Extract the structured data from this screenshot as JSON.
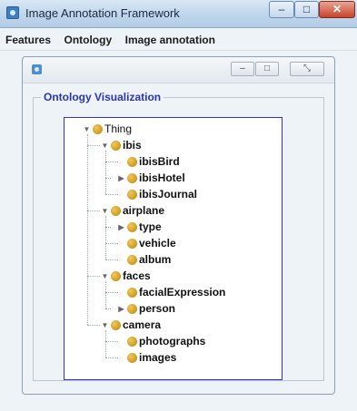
{
  "window": {
    "title": "Image Annotation Framework",
    "controls": {
      "minimize": "–",
      "maximize": "□",
      "close": "✕"
    }
  },
  "menu": [
    "Features",
    "Ontology",
    "Image annotation"
  ],
  "inner_window": {
    "controls": {
      "minimize": "–",
      "maximize": "□",
      "close": "⤡"
    }
  },
  "panel": {
    "title": "Ontology Visualization"
  },
  "tree": {
    "root": "Thing",
    "groups": [
      {
        "label": "ibis",
        "expanded": true,
        "children": [
          {
            "label": "ibisBird",
            "expandable": false
          },
          {
            "label": "ibisHotel",
            "expandable": true
          },
          {
            "label": "ibisJournal",
            "expandable": false
          }
        ]
      },
      {
        "label": "airplane",
        "expanded": true,
        "children": [
          {
            "label": "type",
            "expandable": true
          },
          {
            "label": "vehicle",
            "expandable": false
          },
          {
            "label": "album",
            "expandable": false
          }
        ]
      },
      {
        "label": "faces",
        "expanded": true,
        "children": [
          {
            "label": "facialExpression",
            "expandable": false
          },
          {
            "label": "person",
            "expandable": true
          }
        ]
      },
      {
        "label": "camera",
        "expanded": true,
        "children": [
          {
            "label": "photographs",
            "expandable": false
          },
          {
            "label": "images",
            "expandable": false
          }
        ]
      }
    ]
  }
}
